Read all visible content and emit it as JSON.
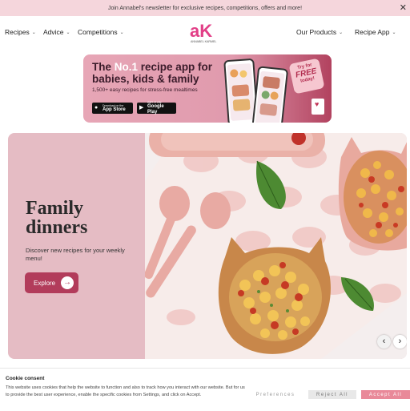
{
  "announcement": {
    "text": "Join Annabel's newsletter for exclusive recipes, competitions, offers and more!",
    "close_icon": "close-icon"
  },
  "nav": {
    "left": [
      {
        "label": "Recipes"
      },
      {
        "label": "Advice"
      },
      {
        "label": "Competitions"
      }
    ],
    "right": [
      {
        "label": "Our Products"
      },
      {
        "label": "Recipe App"
      }
    ],
    "logo": {
      "mark": "aK",
      "sub": "ANNABEL KARMEL"
    }
  },
  "app_banner": {
    "title_pre": "The ",
    "title_no1": "No.1",
    "title_post": " recipe app for babies, kids & family",
    "subtitle": "1,500+ easy recipes for stress-free mealtimes",
    "app_store_small": "Download on the",
    "app_store_big": "App Store",
    "google_small": "GET IT ON",
    "google_big": "Google Play",
    "badge_l1": "Try for",
    "badge_l2": "FREE",
    "badge_l3": "today!"
  },
  "hero": {
    "title_line1": "Family",
    "title_line2": "dinners",
    "description": "Discover new recipes for your weekly menu!",
    "button_label": "Explore",
    "prev": "‹",
    "next": "›"
  },
  "cookie": {
    "title": "Cookie consent",
    "text": "This website uses cookies that help the website to function and also to track how you interact with our website. But for us to provide the best user experience, enable the specific cookies from Settings, and click on Accept.",
    "preferences": "Preferences",
    "reject": "Reject All",
    "accept": "Accept All"
  },
  "colors": {
    "accent": "#b23c5b",
    "topbar": "#f5d6dc",
    "hero_bg": "#e5bcc4",
    "accept": "#e98999"
  }
}
